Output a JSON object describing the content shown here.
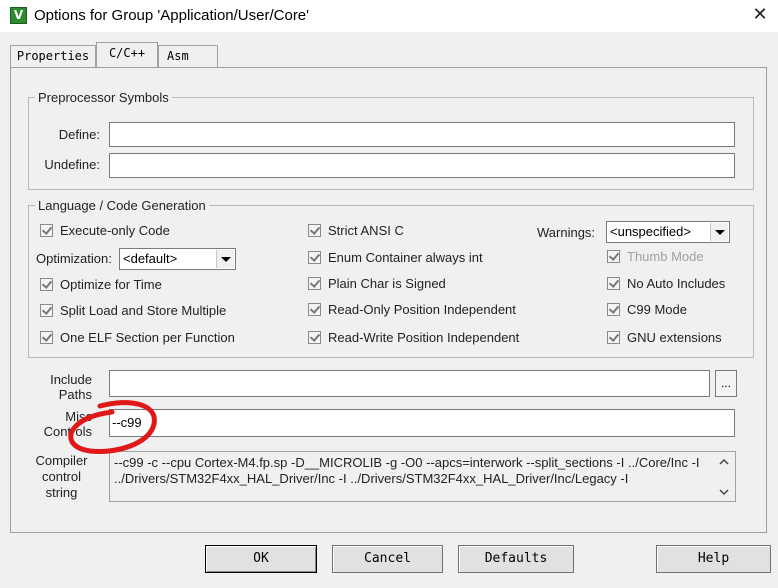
{
  "window": {
    "title": "Options for Group 'Application/User/Core'",
    "close_glyph": "✕",
    "app_icon_letter": "V"
  },
  "tabs": [
    {
      "label": "Properties"
    },
    {
      "label": "C/C++"
    },
    {
      "label": "Asm"
    }
  ],
  "preprocessor": {
    "legend": "Preprocessor Symbols",
    "define_label": "Define:",
    "define_value": "",
    "undefine_label": "Undefine:",
    "undefine_value": ""
  },
  "language": {
    "legend": "Language / Code Generation",
    "execute_only": "Execute-only Code",
    "optimization_label": "Optimization:",
    "optimization_value": "<default>",
    "optimize_for_time": "Optimize for Time",
    "split_load_store": "Split Load and Store Multiple",
    "one_elf_section": "One ELF Section per Function",
    "strict_ansi": "Strict ANSI C",
    "enum_container": "Enum Container always int",
    "plain_char": "Plain Char is Signed",
    "ro_position": "Read-Only Position Independent",
    "rw_position": "Read-Write Position Independent",
    "warnings_label": "Warnings:",
    "warnings_value": "<unspecified>",
    "thumb_mode": "Thumb Mode",
    "no_auto_includes": "No Auto Includes",
    "c99_mode": "C99 Mode",
    "gnu_extensions": "GNU extensions"
  },
  "include_paths": {
    "label_line1": "Include",
    "label_line2": "Paths",
    "value": "",
    "browse_label": "..."
  },
  "misc_controls": {
    "label_line1": "Misc",
    "label_line2": "Controls",
    "value": "--c99"
  },
  "compiler_control": {
    "label_line1": "Compiler",
    "label_line2": "control",
    "label_line3": "string",
    "line1": "--c99 -c --cpu Cortex-M4.fp.sp -D__MICROLIB -g -O0 --apcs=interwork --split_sections -I ../Core/Inc -I",
    "line2": "../Drivers/STM32F4xx_HAL_Driver/Inc -I ../Drivers/STM32F4xx_HAL_Driver/Inc/Legacy -I"
  },
  "buttons": {
    "ok": "OK",
    "cancel": "Cancel",
    "defaults": "Defaults",
    "help": "Help"
  },
  "colors": {
    "annotation": "#e01818",
    "icon_green": "#2d8a2d"
  }
}
